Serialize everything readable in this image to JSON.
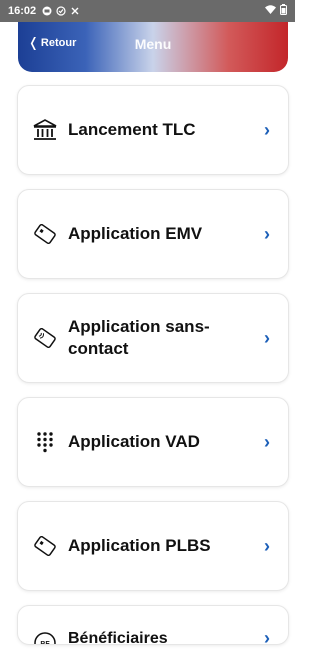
{
  "status_bar": {
    "time": "16:02",
    "icons": [
      "message-icon",
      "check-circle-icon",
      "blocked-icon"
    ],
    "right_icons": [
      "wifi-icon",
      "battery-icon"
    ]
  },
  "header": {
    "back_label": "Retour",
    "title": "Menu"
  },
  "menu": {
    "items": [
      {
        "label": "Lancement TLC",
        "icon": "bank-icon"
      },
      {
        "label": "Application EMV",
        "icon": "card-icon"
      },
      {
        "label": "Application sans-contact",
        "icon": "contactless-card-icon"
      },
      {
        "label": "Application VAD",
        "icon": "keypad-icon"
      },
      {
        "label": "Application PLBS",
        "icon": "card-icon"
      },
      {
        "label": "Bénéficiaires",
        "icon": "beneficiary-icon"
      }
    ]
  },
  "colors": {
    "accent": "#1c5fb8",
    "header_left": "#1c3f95",
    "header_right": "#c3262a"
  }
}
